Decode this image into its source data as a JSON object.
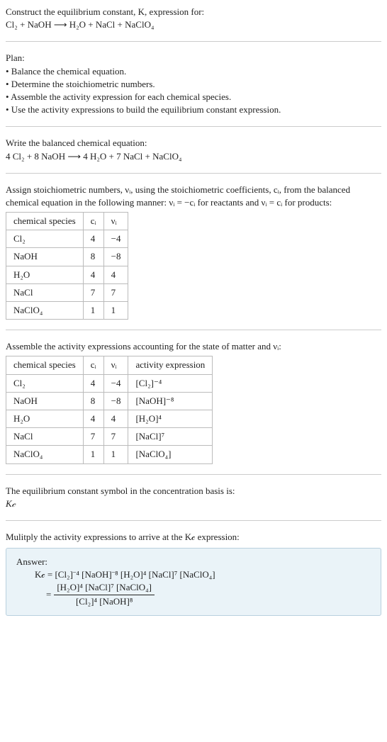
{
  "intro": {
    "line1": "Construct the equilibrium constant, K, expression for:",
    "eq": "Cl₂ + NaOH ⟶ H₂O + NaCl + NaClO₄"
  },
  "plan": {
    "heading": "Plan:",
    "items": [
      "• Balance the chemical equation.",
      "• Determine the stoichiometric numbers.",
      "• Assemble the activity expression for each chemical species.",
      "• Use the activity expressions to build the equilibrium constant expression."
    ]
  },
  "balanced": {
    "line1": "Write the balanced chemical equation:",
    "eq": "4 Cl₂ + 8 NaOH ⟶ 4 H₂O + 7 NaCl + NaClO₄"
  },
  "assign": {
    "text": "Assign stoichiometric numbers, νᵢ, using the stoichiometric coefficients, cᵢ, from the balanced chemical equation in the following manner: νᵢ = −cᵢ for reactants and νᵢ = cᵢ for products:",
    "headers": [
      "chemical species",
      "cᵢ",
      "νᵢ"
    ],
    "rows": [
      [
        "Cl₂",
        "4",
        "−4"
      ],
      [
        "NaOH",
        "8",
        "−8"
      ],
      [
        "H₂O",
        "4",
        "4"
      ],
      [
        "NaCl",
        "7",
        "7"
      ],
      [
        "NaClO₄",
        "1",
        "1"
      ]
    ]
  },
  "activity": {
    "text": "Assemble the activity expressions accounting for the state of matter and νᵢ:",
    "headers": [
      "chemical species",
      "cᵢ",
      "νᵢ",
      "activity expression"
    ],
    "rows": [
      [
        "Cl₂",
        "4",
        "−4",
        "[Cl₂]⁻⁴"
      ],
      [
        "NaOH",
        "8",
        "−8",
        "[NaOH]⁻⁸"
      ],
      [
        "H₂O",
        "4",
        "4",
        "[H₂O]⁴"
      ],
      [
        "NaCl",
        "7",
        "7",
        "[NaCl]⁷"
      ],
      [
        "NaClO₄",
        "1",
        "1",
        "[NaClO₄]"
      ]
    ]
  },
  "symbol": {
    "line1": "The equilibrium constant symbol in the concentration basis is:",
    "sym": "K𝒸"
  },
  "multiply": {
    "text": "Mulitply the activity expressions to arrive at the K𝒸 expression:"
  },
  "answer": {
    "label": "Answer:",
    "line1": "K𝒸 = [Cl₂]⁻⁴ [NaOH]⁻⁸ [H₂O]⁴ [NaCl]⁷ [NaClO₄]",
    "eq2_lhs": "= ",
    "num": "[H₂O]⁴ [NaCl]⁷ [NaClO₄]",
    "den": "[Cl₂]⁴ [NaOH]⁸"
  }
}
